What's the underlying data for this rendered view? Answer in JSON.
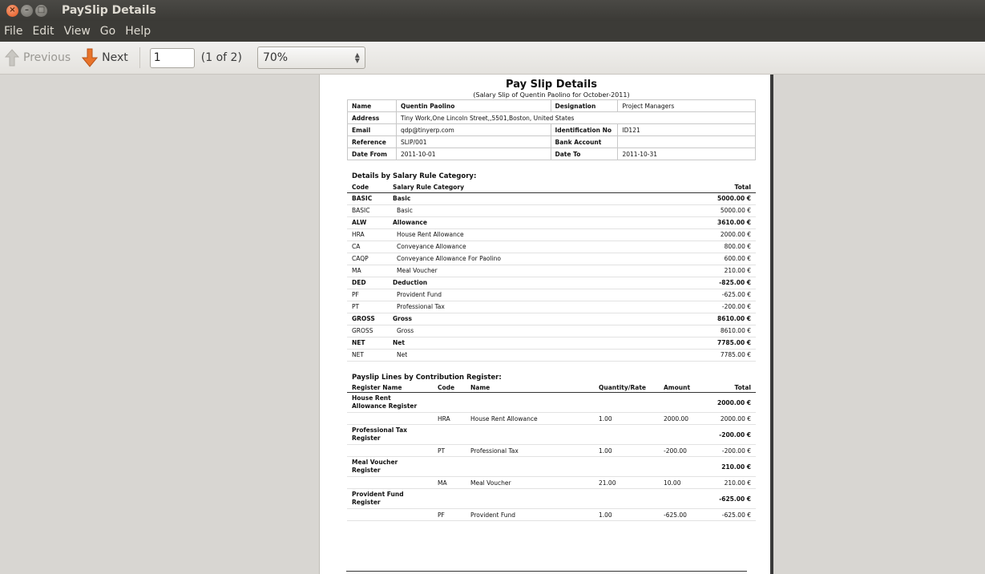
{
  "window": {
    "title": "PaySlip Details"
  },
  "menu": [
    "File",
    "Edit",
    "View",
    "Go",
    "Help"
  ],
  "toolbar": {
    "previous_label": "Previous",
    "next_label": "Next",
    "page_value": "1",
    "page_count": "(1 of 2)",
    "zoom": "70%"
  },
  "doc": {
    "title": "Pay Slip Details",
    "subtitle": "(Salary Slip of Quentin Paolino for October-2011)",
    "info": {
      "name_label": "Name",
      "name": "Quentin Paolino",
      "designation_label": "Designation",
      "designation": "Project Managers",
      "address_label": "Address",
      "address": "Tiny Work,One Lincoln Street,,5501,Boston, United States",
      "email_label": "Email",
      "email": "qdp@tinyerp.com",
      "idno_label": "Identification No",
      "idno": "ID121",
      "reference_label": "Reference",
      "reference": "SLIP/001",
      "bank_label": "Bank Account",
      "bank": "",
      "datefrom_label": "Date From",
      "datefrom": "2011-10-01",
      "dateto_label": "Date To",
      "dateto": "2011-10-31"
    },
    "category_section": {
      "title": "Details by Salary Rule Category:",
      "headers": {
        "code": "Code",
        "category": "Salary Rule Category",
        "total": "Total"
      },
      "rows": [
        {
          "code": "BASIC",
          "name": "Basic",
          "total": "5000.00 €",
          "bold": true
        },
        {
          "code": "BASIC",
          "name": "Basic",
          "total": "5000.00 €",
          "bold": false
        },
        {
          "code": "ALW",
          "name": "Allowance",
          "total": "3610.00 €",
          "bold": true
        },
        {
          "code": "HRA",
          "name": "House Rent Allowance",
          "total": "2000.00 €",
          "bold": false
        },
        {
          "code": "CA",
          "name": "Conveyance Allowance",
          "total": "800.00 €",
          "bold": false
        },
        {
          "code": "CAQP",
          "name": "Conveyance Allowance For Paolino",
          "total": "600.00 €",
          "bold": false
        },
        {
          "code": "MA",
          "name": "Meal Voucher",
          "total": "210.00 €",
          "bold": false
        },
        {
          "code": "DED",
          "name": "Deduction",
          "total": "-825.00 €",
          "bold": true
        },
        {
          "code": "PF",
          "name": "Provident Fund",
          "total": "-625.00 €",
          "bold": false
        },
        {
          "code": "PT",
          "name": "Professional Tax",
          "total": "-200.00 €",
          "bold": false
        },
        {
          "code": "GROSS",
          "name": "Gross",
          "total": "8610.00 €",
          "bold": true
        },
        {
          "code": "GROSS",
          "name": "Gross",
          "total": "8610.00 €",
          "bold": false
        },
        {
          "code": "NET",
          "name": "Net",
          "total": "7785.00 €",
          "bold": true
        },
        {
          "code": "NET",
          "name": "Net",
          "total": "7785.00 €",
          "bold": false
        }
      ]
    },
    "register_section": {
      "title": "Payslip Lines by Contribution Register:",
      "headers": {
        "register": "Register Name",
        "code": "Code",
        "name": "Name",
        "qty": "Quantity/Rate",
        "amount": "Amount",
        "total": "Total"
      },
      "groups": [
        {
          "register": "House Rent Allowance Register",
          "total": "2000.00 €",
          "line": {
            "code": "HRA",
            "name": "House Rent Allowance",
            "qty": "1.00",
            "amount": "2000.00",
            "total": "2000.00 €"
          }
        },
        {
          "register": "Professional Tax Register",
          "total": "-200.00 €",
          "line": {
            "code": "PT",
            "name": "Professional Tax",
            "qty": "1.00",
            "amount": "-200.00",
            "total": "-200.00 €"
          }
        },
        {
          "register": "Meal Voucher Register",
          "total": "210.00 €",
          "line": {
            "code": "MA",
            "name": "Meal Voucher",
            "qty": "21.00",
            "amount": "10.00",
            "total": "210.00 €"
          }
        },
        {
          "register": "Provident Fund Register",
          "total": "-625.00 €",
          "line": {
            "code": "PF",
            "name": "Provident Fund",
            "qty": "1.00",
            "amount": "-625.00",
            "total": "-625.00 €"
          }
        }
      ]
    }
  }
}
